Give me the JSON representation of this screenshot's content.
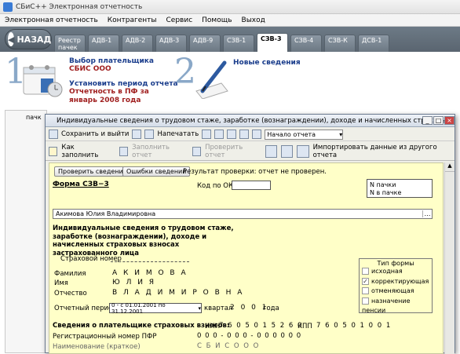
{
  "app": {
    "title": "СБиС++ Электронная отчетность"
  },
  "menu": [
    "Электронная отчетность",
    "Контрагенты",
    "Сервис",
    "Помощь",
    "Выход"
  ],
  "back_label": "НАЗАД",
  "tabs": [
    {
      "label": "Реестр пачек",
      "active": false
    },
    {
      "label": "АДВ-1",
      "active": false
    },
    {
      "label": "АДВ-2",
      "active": false
    },
    {
      "label": "АДВ-3",
      "active": false
    },
    {
      "label": "АДВ-9",
      "active": false
    },
    {
      "label": "СЗВ-1",
      "active": false
    },
    {
      "label": "СЗВ-3",
      "active": true
    },
    {
      "label": "СЗВ-4",
      "active": false
    },
    {
      "label": "СЗВ-К",
      "active": false
    },
    {
      "label": "ДСВ-1",
      "active": false
    }
  ],
  "steps": {
    "step1_num": "1",
    "step1_link": "Выбор плательщика",
    "step1_value": "СБИС ООО",
    "step1_link2": "Установить период отчета",
    "step1_value2": "Отчетность в ПФ за январь 2008 года",
    "step2_num": "2",
    "step2_link": "Новые сведения"
  },
  "left_col_label": "пачк",
  "dialog": {
    "title": "Индивидуальные сведения о трудовом стаже, заработке (вознаграждении), доходе и начисленных страховых взносах застр...",
    "tb1": {
      "save_close": "Сохранить и выйти",
      "print": "Напечатать",
      "nav_value": "Начало отчета"
    },
    "tb2": {
      "how_fill": "Как заполнить",
      "fill_report": "Заполнить отчет",
      "check_report": "Проверить отчет",
      "import": "Импортировать данные из другого отчета"
    },
    "form": {
      "check_btn": "Проверить сведения",
      "errors_btn": "Ошибки сведений",
      "check_result": "Результат проверки: отчет не проверен.",
      "form_name": "Форма СЗВ−3",
      "okud_label": "Код по ОКУД",
      "pack_no": "N пачки",
      "in_pack": "N в пачке",
      "person_select": "Акимова Юлия Владимировна",
      "heading": "Индивидуальные сведения о трудовом стаже, заработке (вознаграждении), доходе и начисленных страховых взносах застрахованного лица",
      "ins_no_label": "Страховой номер",
      "surname_label": "Фамилия",
      "surname": "А К И М О В А",
      "name_label": "Имя",
      "name": "Ю Л И Я",
      "patronymic_label": "Отчество",
      "patronymic": "В Л А Д И М И Р О В Н А",
      "period_label": "Отчетный период:",
      "period_value": "0 - с 01.01.2001 по 31.12.2001",
      "quarter_label": "квартал",
      "year_value": "2 0 0 1",
      "year_label": "года",
      "form_type_title": "Тип формы",
      "form_types": [
        {
          "label": "исходная",
          "checked": false
        },
        {
          "label": "корректирующая",
          "checked": true
        },
        {
          "label": "отменяющая",
          "checked": false
        },
        {
          "label": "назначение пенсии",
          "checked": false
        }
      ],
      "payer_label": "Сведения о плательщике страховых взносов:",
      "inn_label": "ИНН",
      "inn_value": "7 6 0 5 0 1 5 2 6 0",
      "kpp_label": "КПП",
      "kpp_value": "7 6 0 5 0 1 0 0 1",
      "reg_label": "Регистрационный номер ПФР",
      "reg_value": "0 0 0 - 0 0 0 - 0 0 0 0 0 0",
      "org_label": "Наименование (краткое)",
      "org_value": "С Б И С   О О О"
    }
  }
}
